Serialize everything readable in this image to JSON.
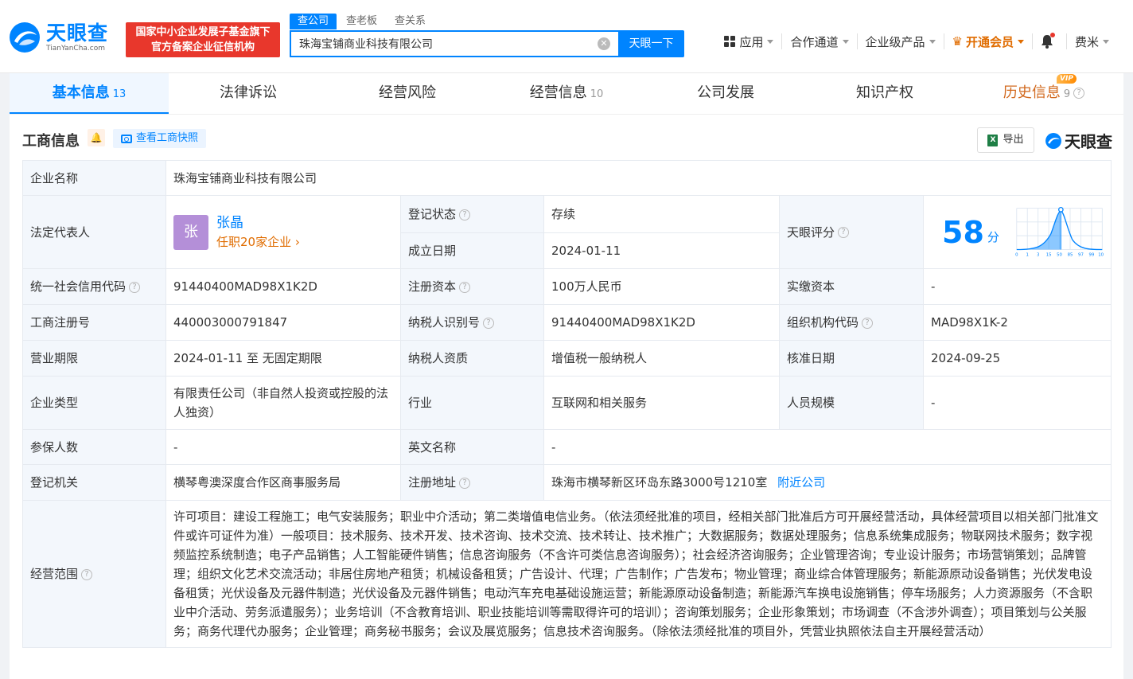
{
  "header": {
    "logo_cn": "天眼查",
    "logo_en": "TianYanCha.com",
    "banner_line1": "国家中小企业发展子基金旗下",
    "banner_line2": "官方备案企业征信机构",
    "search_tabs": [
      "查公司",
      "查老板",
      "查关系"
    ],
    "search_value": "珠海宝铺商业科技有限公司",
    "search_button": "天眼一下",
    "nav": {
      "apps": "应用",
      "partner": "合作通道",
      "enterprise": "企业级产品",
      "vip": "开通会员",
      "user": "费米"
    }
  },
  "tabs": [
    {
      "label": "基本信息",
      "count": "13"
    },
    {
      "label": "法律诉讼",
      "count": ""
    },
    {
      "label": "经营风险",
      "count": ""
    },
    {
      "label": "经营信息",
      "count": "10"
    },
    {
      "label": "公司发展",
      "count": ""
    },
    {
      "label": "知识产权",
      "count": ""
    },
    {
      "label": "历史信息",
      "count": "9",
      "badge": "VIP"
    }
  ],
  "section": {
    "title": "工商信息",
    "snapshot_button": "查看工商快照",
    "export_button": "导出",
    "brand": "天眼查"
  },
  "info": {
    "company_name_label": "企业名称",
    "company_name": "珠海宝铺商业科技有限公司",
    "legal_rep_label": "法定代表人",
    "legal_rep_avatar": "张",
    "legal_rep_name": "张晶",
    "legal_rep_sub": "任职20家企业",
    "reg_status_label": "登记状态",
    "reg_status": "存续",
    "found_date_label": "成立日期",
    "found_date": "2024-01-11",
    "score_label": "天眼评分",
    "score": "58",
    "score_unit": "分",
    "score_axis": [
      "0",
      "1",
      "3",
      "15",
      "50",
      "85",
      "97",
      "99",
      "100"
    ],
    "credit_code_label": "统一社会信用代码",
    "credit_code": "91440400MAD98X1K2D",
    "reg_capital_label": "注册资本",
    "reg_capital": "100万人民币",
    "paid_capital_label": "实缴资本",
    "paid_capital": "-",
    "reg_no_label": "工商注册号",
    "reg_no": "440003000791847",
    "taxpayer_id_label": "纳税人识别号",
    "taxpayer_id": "91440400MAD98X1K2D",
    "org_code_label": "组织机构代码",
    "org_code": "MAD98X1K-2",
    "term_label": "营业期限",
    "term": "2024-01-11 至 无固定期限",
    "taxpayer_qual_label": "纳税人资质",
    "taxpayer_qual": "增值税一般纳税人",
    "approve_date_label": "核准日期",
    "approve_date": "2024-09-25",
    "type_label": "企业类型",
    "type": "有限责任公司（非自然人投资或控股的法人独资）",
    "industry_label": "行业",
    "industry": "互联网和相关服务",
    "staff_label": "人员规模",
    "staff": "-",
    "insured_label": "参保人数",
    "insured": "-",
    "english_name_label": "英文名称",
    "english_name": "-",
    "authority_label": "登记机关",
    "authority": "横琴粤澳深度合作区商事服务局",
    "address_label": "注册地址",
    "address": "珠海市横琴新区环岛东路3000号1210室",
    "nearby_link": "附近公司",
    "scope_label": "经营范围",
    "scope": "许可项目：建设工程施工；电气安装服务；职业中介活动；第二类增值电信业务。（依法须经批准的项目，经相关部门批准后方可开展经营活动，具体经营项目以相关部门批准文件或许可证件为准）一般项目：技术服务、技术开发、技术咨询、技术交流、技术转让、技术推广；大数据服务；数据处理服务；信息系统集成服务；物联网技术服务；数字视频监控系统制造；电子产品销售；人工智能硬件销售；信息咨询服务（不含许可类信息咨询服务）；社会经济咨询服务；企业管理咨询；专业设计服务；市场营销策划；品牌管理；组织文化艺术交流活动；非居住房地产租赁；机械设备租赁；广告设计、代理；广告制作；广告发布；物业管理；商业综合体管理服务；新能源原动设备销售；光伏发电设备租赁；光伏设备及元器件制造；光伏设备及元器件销售；电动汽车充电基础设施运营；新能源原动设备制造；新能源汽车换电设施销售；停车场服务；人力资源服务（不含职业中介活动、劳务派遣服务）；业务培训（不含教育培训、职业技能培训等需取得许可的培训）；咨询策划服务；企业形象策划；市场调查（不含涉外调查）；项目策划与公关服务；商务代理代办服务；企业管理；商务秘书服务；会议及展览服务；信息技术咨询服务。（除依法须经批准的项目外，凭营业执照依法自主开展经营活动）"
  },
  "colors": {
    "brand_blue": "#0084ff",
    "banner_red": "#e8372c",
    "vip_orange": "#e06c00",
    "status_green": "#0da958"
  }
}
